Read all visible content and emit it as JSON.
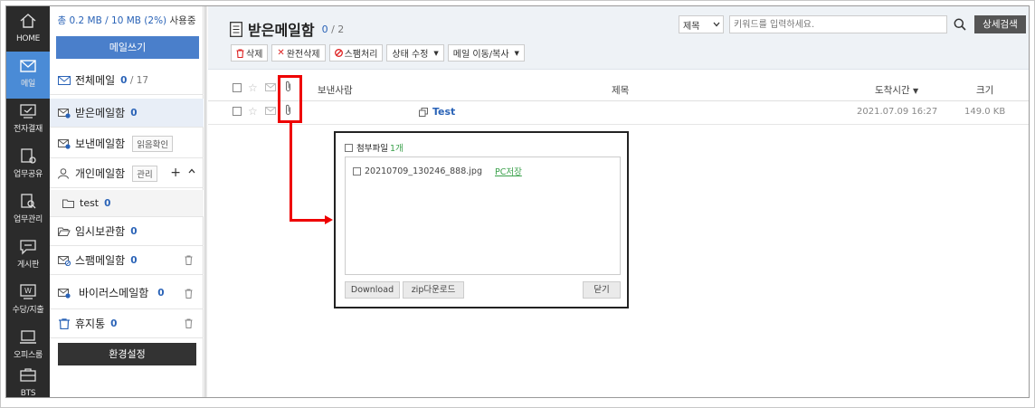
{
  "nav": {
    "items": [
      {
        "label": "HOME",
        "icon": "home-icon"
      },
      {
        "label": "메일",
        "icon": "mail-icon"
      },
      {
        "label": "전자결재",
        "icon": "approval-icon"
      },
      {
        "label": "업무공유",
        "icon": "work-share-icon"
      },
      {
        "label": "업무관리",
        "icon": "work-manage-icon"
      },
      {
        "label": "게시판",
        "icon": "board-icon"
      },
      {
        "label": "수당/지출",
        "icon": "allowance-icon"
      },
      {
        "label": "오피스룸",
        "icon": "office-room-icon"
      },
      {
        "label": "BTS",
        "icon": "bts-icon"
      }
    ],
    "active_index": 1
  },
  "sidebar": {
    "usage": {
      "used": "총 0.2 MB / 10 MB (2%)",
      "suffix": " 사용중"
    },
    "compose_label": "메일쓰기",
    "mailboxes": {
      "all": {
        "label": "전체메일",
        "count": "0",
        "total": " / 17"
      },
      "inbox": {
        "label": "받은메일함",
        "count": "0"
      },
      "sent": {
        "label": "보낸메일함",
        "tag": "읽음확인"
      },
      "personal": {
        "label": "개인메일함",
        "tag": "관리"
      },
      "test": {
        "label": "test",
        "count": "0"
      },
      "drafts": {
        "label": "임시보관함",
        "count": "0"
      },
      "spam": {
        "label": "스팸메일함",
        "count": "0"
      },
      "virus": {
        "label": "바이러스메일함",
        "count": "0"
      },
      "trash": {
        "label": "휴지통",
        "count": "0"
      }
    },
    "settings_label": "환경설정"
  },
  "main": {
    "title": "받은메일함",
    "count_unread": "0",
    "count_total": " / 2",
    "search": {
      "scope": "제목",
      "placeholder": "키워드를 입력하세요.",
      "advanced_label": "상세검색"
    },
    "toolbar": {
      "delete": "삭제",
      "perm_delete": "완전삭제",
      "spam": "스팸처리",
      "status": "상태 수정",
      "move_copy": "메일 이동/복사"
    },
    "columns": {
      "sender": "보낸사람",
      "subject": "제목",
      "received": "도착시간",
      "size": "크기"
    },
    "rows": [
      {
        "subject": "Test",
        "received": "2021.07.09 16:27",
        "size": "149.0 KB",
        "has_attachment": true
      }
    ]
  },
  "attachment_popup": {
    "title": "첨부파일",
    "count": "1개",
    "files": [
      {
        "name": "20210709_130246_888.jpg",
        "save_label": "PC저장"
      }
    ],
    "download_label": "Download",
    "zip_label": "zip다운로드",
    "close_label": "닫기"
  },
  "colors": {
    "accent": "#4a7fcb",
    "highlight": "#e00000",
    "iconbar": "#2b2b2b",
    "link_green": "#39a04a"
  }
}
